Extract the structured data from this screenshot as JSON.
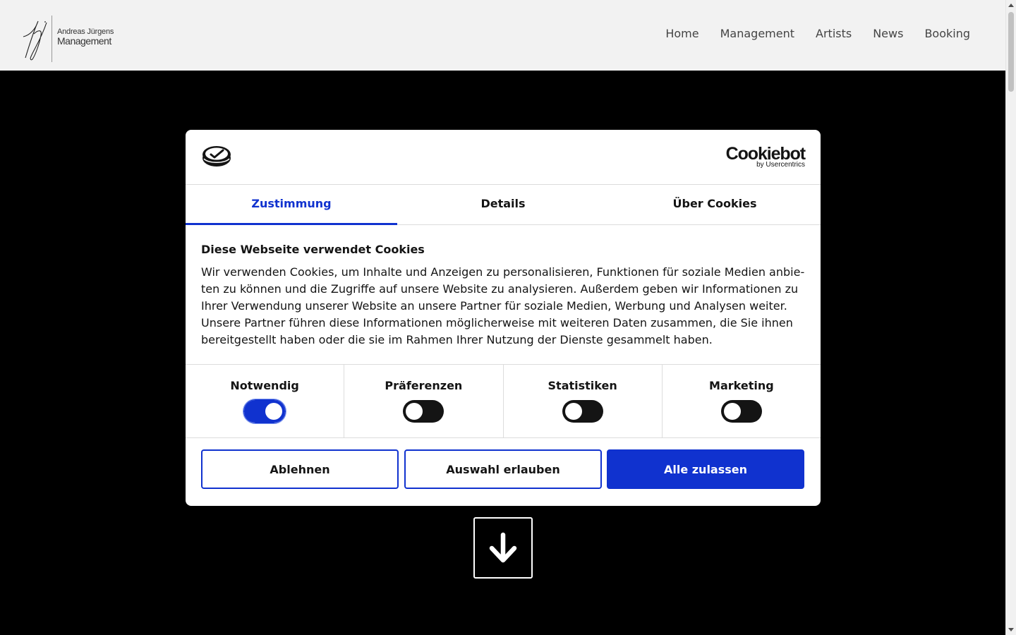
{
  "header": {
    "logo": {
      "line1": "Andreas Jürgens",
      "line2": "Management"
    },
    "nav": [
      "Home",
      "Management",
      "Artists",
      "News",
      "Booking"
    ]
  },
  "cookie_dialog": {
    "brand": {
      "name": "Cookiebot",
      "sub": "by Usercentrics"
    },
    "tabs": [
      {
        "label": "Zustimmung",
        "active": true
      },
      {
        "label": "Details",
        "active": false
      },
      {
        "label": "Über Cookies",
        "active": false
      }
    ],
    "title": "Diese Webseite verwendet Cookies",
    "text": "Wir verwenden Cookies, um Inhalte und Anzeigen zu personalisieren, Funktionen für soziale Medien anbie­ten zu können und die Zugriffe auf unsere Website zu analysieren. Außerdem geben wir Informationen zu Ihrer Verwendung unserer Website an unsere Partner für soziale Medien, Werbung und Analysen weiter. Unsere Partner führen diese Informationen möglicherweise mit weiteren Daten zusammen, die Sie ihnen bereitgestellt haben oder die sie im Rahmen Ihrer Nutzung der Dienste gesammelt haben.",
    "categories": [
      {
        "label": "Notwendig",
        "enabled": true
      },
      {
        "label": "Präferenzen",
        "enabled": false
      },
      {
        "label": "Statistiken",
        "enabled": false
      },
      {
        "label": "Marketing",
        "enabled": false
      }
    ],
    "buttons": {
      "decline": "Ablehnen",
      "allow_selection": "Auswahl erlauben",
      "allow_all": "Alle zulassen"
    }
  },
  "colors": {
    "accent": "#1032cf",
    "header_bg": "#f2f2f2",
    "page_bg": "#000000"
  },
  "icons": {
    "scroll_down": "arrow-down-icon",
    "cookiebot": "cookie-consent-icon"
  }
}
